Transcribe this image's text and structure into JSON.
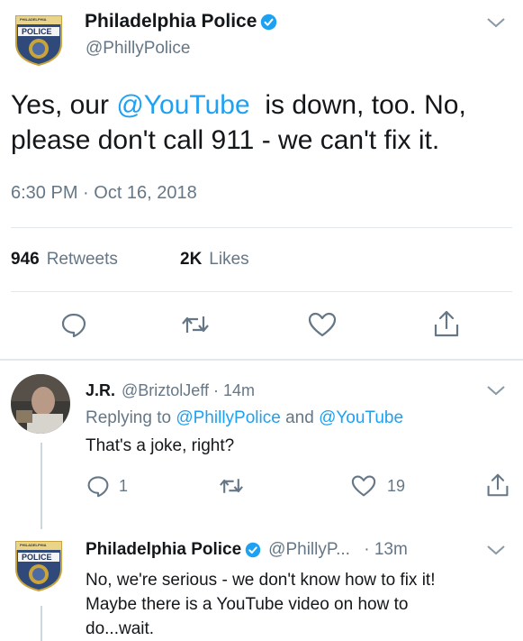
{
  "main_tweet": {
    "name": "Philadelphia Police",
    "handle": "@PhillyPolice",
    "text_before": "Yes, our ",
    "mention": "@YouTube",
    "text_after": "  is down, too. No, please don't call 911 - we can't fix it.",
    "timestamp": "6:30 PM · Oct 16, 2018",
    "retweets_count": "946",
    "retweets_label": "Retweets",
    "likes_count": "2K",
    "likes_label": "Likes",
    "patch_text": "POLICE",
    "patch_small": "PHILADELPHIA"
  },
  "reply1": {
    "name": "J.R.",
    "handle": "@BriztolJeff",
    "time": " · 14m",
    "reply_prefix": "Replying to ",
    "reply_mention1": "@PhillyPolice",
    "reply_and": " and ",
    "reply_mention2": "@YouTube",
    "text": "That's a joke, right?",
    "reply_count": "1",
    "like_count": "19"
  },
  "reply2": {
    "name": "Philadelphia Police",
    "handle": "@PhillyP...",
    "time": " · 13m",
    "line1": "No, we're serious - we don't know how to fix it!",
    "line2": "Maybe there is a YouTube video on how to",
    "line3": "do...wait."
  },
  "colors": {
    "blue": "#1da1f2",
    "muted": "#657786",
    "divider": "#e1e8ed"
  },
  "icons": [
    "verified-badge-icon",
    "chevron-down-icon",
    "reply-icon",
    "retweet-icon",
    "like-icon",
    "share-icon"
  ]
}
